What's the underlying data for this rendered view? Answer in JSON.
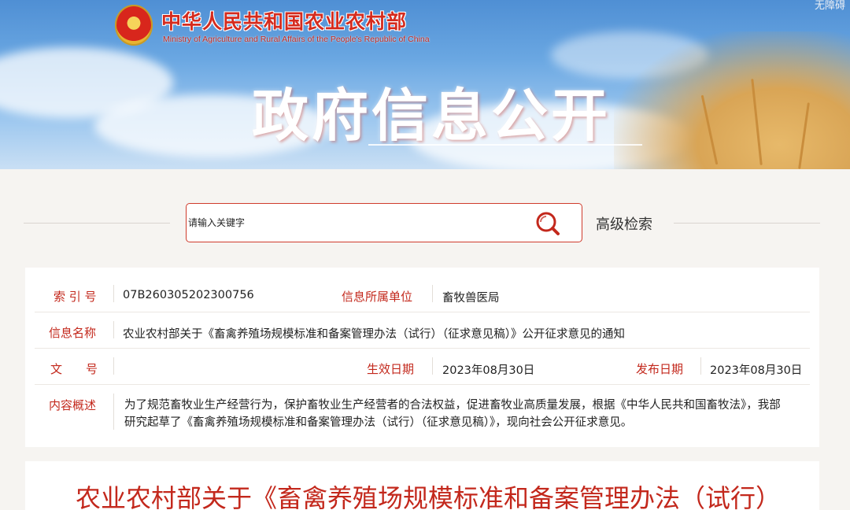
{
  "header": {
    "ministry_cn": "中华人民共和国农业农村部",
    "ministry_en": "Ministry of Agriculture and Rural Affairs of the People's Republic of China",
    "accessibility": "无障碍",
    "section_title": "政府信息公开"
  },
  "search": {
    "placeholder": "请输入关键字",
    "advanced_label": "高级检索",
    "icon": "search-icon"
  },
  "info": {
    "index_label": "索 引 号",
    "index_value": "07B260305202300756",
    "org_label": "信息所属单位",
    "org_value": "畜牧兽医局",
    "name_label": "信息名称",
    "name_value": "农业农村部关于《畜禽养殖场规模标准和备案管理办法（试行）（征求意见稿）》公开征求意见的通知",
    "doc_label": "文　　号",
    "doc_value": "",
    "effective_label": "生效日期",
    "effective_value": "2023年08月30日",
    "publish_label": "发布日期",
    "publish_value": "2023年08月30日",
    "summary_label": "内容概述",
    "summary_value": "为了规范畜牧业生产经营行为，保护畜牧业生产经营者的合法权益，促进畜牧业高质量发展，根据《中华人民共和国畜牧法》，我部研究起草了《畜禽养殖场规模标准和备案管理办法（试行）（征求意见稿）》，现向社会公开征求意见。"
  },
  "article": {
    "title": "农业农村部关于《畜禽养殖场规模标准和备案管理办法（试行）"
  },
  "colors": {
    "accent_red": "#c3281c",
    "search_border": "#cf3b2c",
    "page_bg": "#f6f4f1"
  }
}
